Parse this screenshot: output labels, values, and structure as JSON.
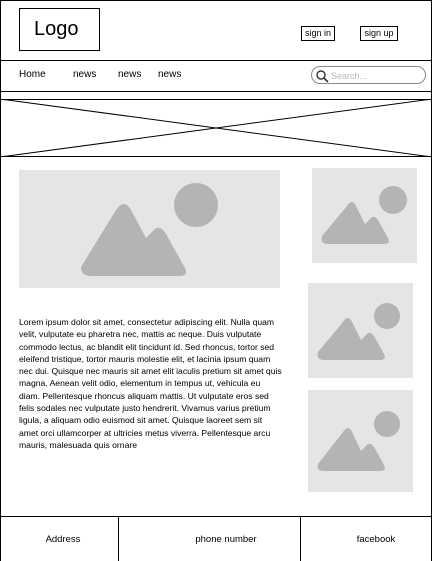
{
  "header": {
    "logo": "Logo",
    "sign_in": "sign in",
    "sign_up": "sign up"
  },
  "nav": {
    "items": [
      "Home",
      "news",
      "news",
      "news"
    ],
    "search_placeholder": "Search..."
  },
  "content": {
    "body_text": "Lorem ipsum dolor sit amet, consectetur adipiscing elit. Nulla quam velit, vulputate eu pharetra nec, mattis ac neque. Duis vulputate commodo lectus, ac blandit elit tincidunt id. Sed rhoncus, tortor sed eleifend tristique, tortor mauris molestie elit, et lacinia ipsum quam nec dui. Quisque nec mauris sit amet elit iaculis pretium sit amet quis magna. Aenean velit odio, elementum in tempus ut, vehicula eu diam. Pellentesque rhoncus aliquam mattis. Ut vulputate eros sed felis sodales nec vulputate justo hendrerit. Vivamus varius pretium ligula, a aliquam odio euismod sit amet. Quisque laoreet sem sit amet orci ullamcorper at ultricies metus viverra. Pellentesque arcu mauris, malesuada quis ornare"
  },
  "footer": {
    "address": "Address",
    "phone": "phone number",
    "facebook": "facebook"
  },
  "colors": {
    "placeholder_fill": "#e5e5e5",
    "placeholder_icon": "#b4b4b4",
    "lines": "#000000"
  },
  "icons": {
    "image_placeholder": "image-placeholder-icon",
    "search": "search-icon",
    "banner": "banner-placeholder"
  }
}
